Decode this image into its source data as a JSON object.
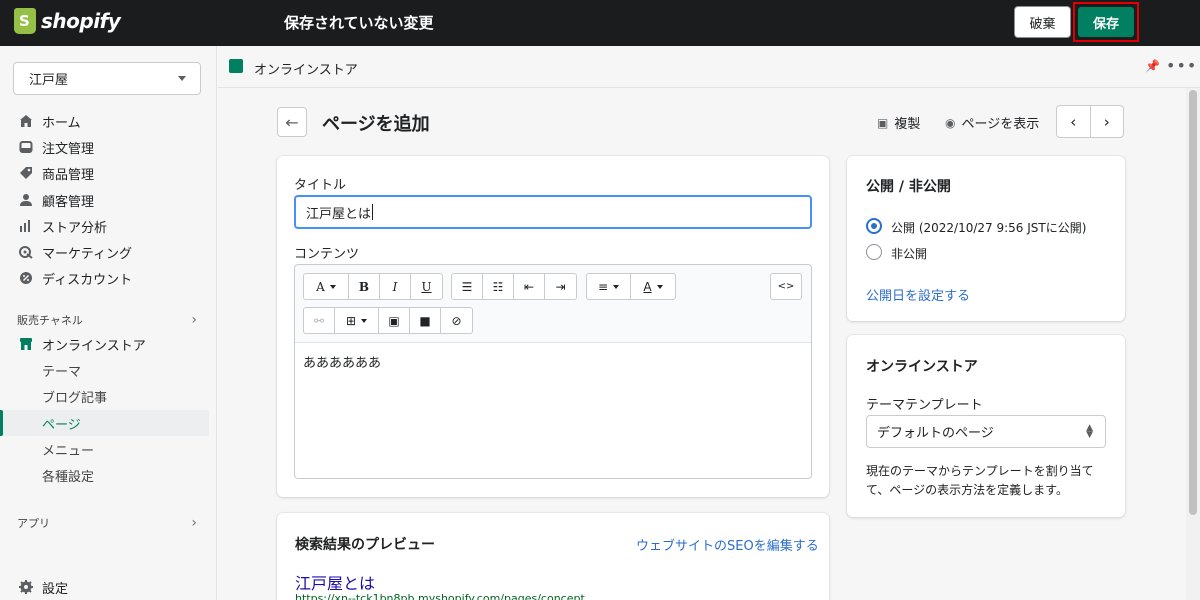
{
  "topbar": {
    "logo_text": "shopify",
    "unsaved_message": "保存されていない変更",
    "discard_label": "破棄",
    "save_label": "保存"
  },
  "sidebar": {
    "store_name": "江戸屋",
    "nav": [
      {
        "label": "ホーム",
        "icon": "home-icon"
      },
      {
        "label": "注文管理",
        "icon": "inbox-icon"
      },
      {
        "label": "商品管理",
        "icon": "tag-icon"
      },
      {
        "label": "顧客管理",
        "icon": "person-icon"
      },
      {
        "label": "ストア分析",
        "icon": "bar-chart-icon"
      },
      {
        "label": "マーケティング",
        "icon": "target-icon"
      },
      {
        "label": "ディスカウント",
        "icon": "discount-icon"
      }
    ],
    "sales_channels_heading": "販売チャネル",
    "online_store_label": "オンラインストア",
    "online_store_sub": [
      "テーマ",
      "ブログ記事",
      "ページ",
      "メニュー",
      "各種設定"
    ],
    "active_sub": "ページ",
    "apps_heading": "アプリ",
    "settings_label": "設定"
  },
  "channelbar": {
    "label": "オンラインストア"
  },
  "page": {
    "title": "ページを追加",
    "duplicate_label": "複製",
    "view_label": "ページを表示"
  },
  "content_card": {
    "title_label": "タイトル",
    "title_value": "江戸屋とは",
    "content_label": "コンテンツ",
    "body_text": "ああああああ",
    "toolbar": {
      "font_btn": "A",
      "bold_btn": "B",
      "italic_btn": "I",
      "underline_btn": "U",
      "color_btn": "A",
      "code_btn": "<>"
    }
  },
  "seo_card": {
    "heading": "検索結果のプレビュー",
    "edit_link": "ウェブサイトのSEOを編集する",
    "preview_title": "江戸屋とは",
    "preview_url": "https://xn--tck1bn8pb.myshopify.com/pages/concept"
  },
  "visibility_card": {
    "heading": "公開 / 非公開",
    "visible_label": "公開 (2022/10/27 9:56 JSTに公開)",
    "hidden_label": "非公開",
    "selected": "visible",
    "set_date_link": "公開日を設定する"
  },
  "online_store_card": {
    "heading": "オンラインストア",
    "template_label": "テーマテンプレート",
    "template_value": "デフォルトのページ",
    "help_text": "現在のテーマからテンプレートを割り当てて、ページの表示方法を定義します。"
  },
  "colors": {
    "primary_green": "#008060",
    "highlight_red": "#e00000",
    "link_blue": "#2c6ecb",
    "topbar_bg": "#1a1c1d"
  }
}
